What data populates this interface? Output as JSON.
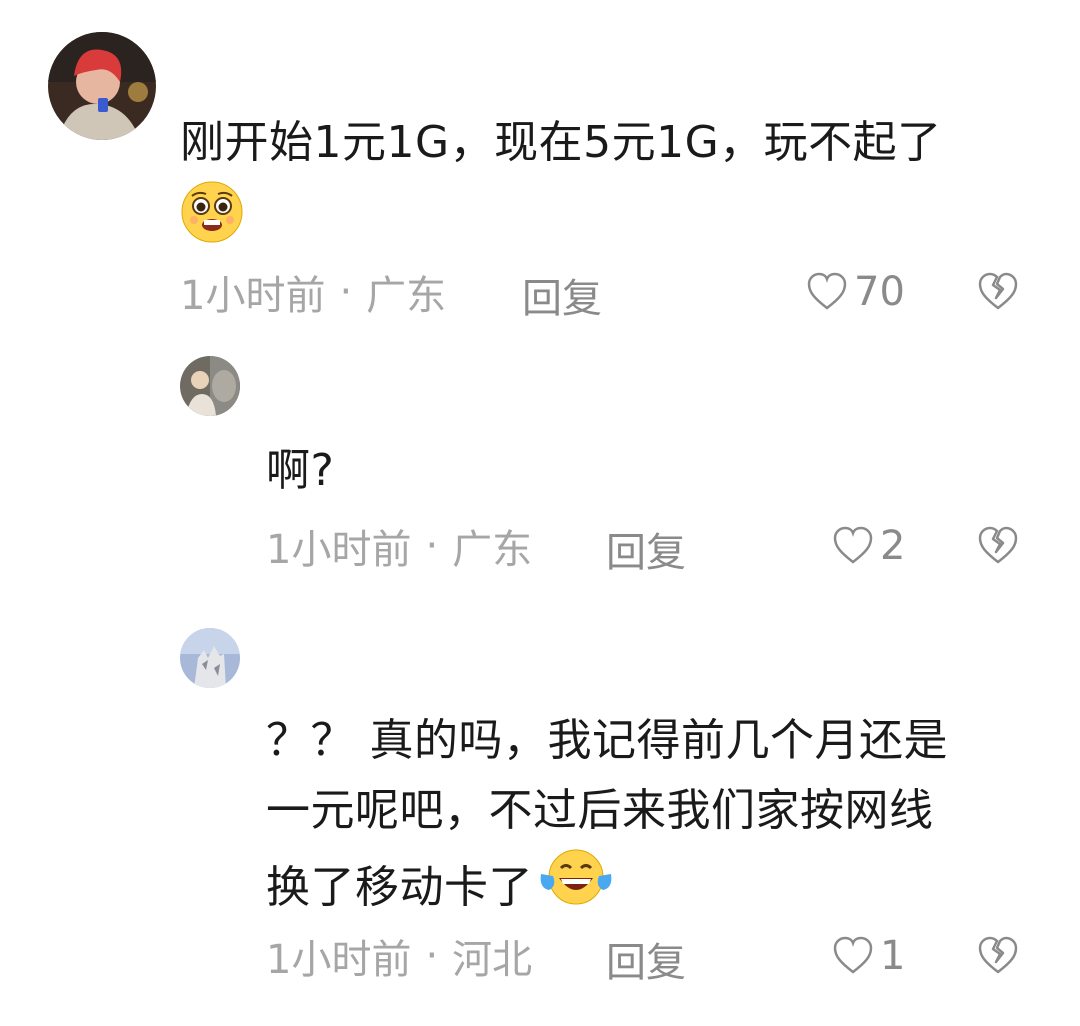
{
  "comments": [
    {
      "text": "刚开始1元1G，现在5元1G，玩不起了",
      "emoji": "pleading-face-emoji",
      "time": "1小时前",
      "separator": "·",
      "location": "广东",
      "reply_label": "回复",
      "likes": "70"
    },
    {
      "text": "啊?",
      "time": "1小时前",
      "separator": "·",
      "location": "广东",
      "reply_label": "回复",
      "likes": "2"
    },
    {
      "line1": "？？ 真的吗，我记得前几个月还是",
      "line2": "一元呢吧，不过后来我们家按网线",
      "line3": "换了移动卡了",
      "emoji": "tears-of-joy-emoji",
      "time": "1小时前",
      "separator": "·",
      "location": "河北",
      "reply_label": "回复",
      "likes": "1"
    }
  ],
  "colors": {
    "text": "#1a1a1a",
    "meta": "#a6a6a6",
    "action": "#8a8a8a"
  }
}
